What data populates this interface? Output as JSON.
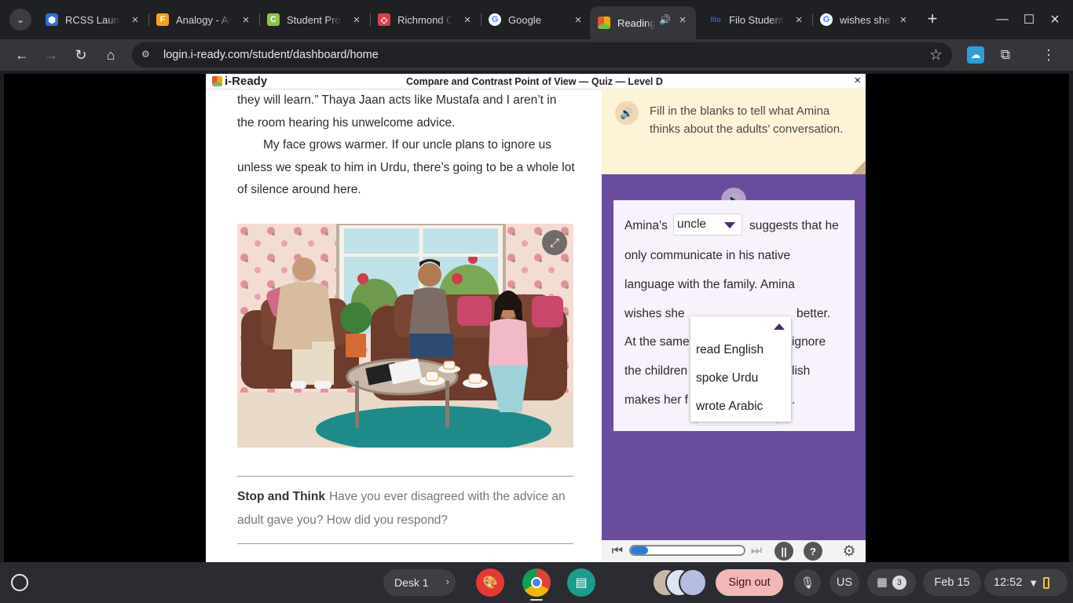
{
  "browser": {
    "tabs": [
      {
        "title": "RCSS Launchpad",
        "icon": "rcss-icon",
        "color": "#2f6fd6"
      },
      {
        "title": "Analogy - Ar",
        "icon": "analogy-icon",
        "color": "#f6a21b"
      },
      {
        "title": "Student Pro",
        "icon": "student-pro-icon",
        "color": "#8bc34a"
      },
      {
        "title": "Richmond C",
        "icon": "richmond-icon",
        "color": "#d9434a"
      },
      {
        "title": "Google",
        "icon": "google-icon",
        "color": "#4285f4"
      },
      {
        "title": "Reading",
        "icon": "iready-icon",
        "color": "#6cc04a",
        "active": true
      },
      {
        "title": "Filo Student",
        "icon": "filo-icon",
        "color": "#3b5bdb"
      },
      {
        "title": "wishes she",
        "icon": "google-icon",
        "color": "#4285f4"
      }
    ],
    "url": "login.i-ready.com/student/dashboard/home"
  },
  "app": {
    "logo": "i-Ready",
    "quiz_title": "Compare and Contrast Point of View — Quiz — Level D",
    "close": "×"
  },
  "passage": {
    "p1": "they will learn.” Thaya Jaan acts like Mustafa and I aren’t in the room hearing his unwelcome advice.",
    "p2": "My face grows warmer. If our uncle plans to ignore us unless we speak to him in Urdu, there’s going to be a whole lot of silence around here."
  },
  "stop_think": {
    "label": "Stop and Think",
    "text": "Have you ever disagreed with the advice an adult gave you? How did you respond?"
  },
  "question": {
    "instruction": "Fill in the blanks to tell what Amina thinks about the adults’ conversation.",
    "line1_a": "Amina’s",
    "dropdown1_value": "uncle",
    "line1_b": "suggests that he",
    "line2": "only communicate in his native",
    "line3": "language with the family. Amina",
    "line4_a": "wishes she",
    "line4_b": "better.",
    "line5_a": "At the same",
    "line5_b": "ignore",
    "line6_a": "the children",
    "line6_b": "lish",
    "line7_a": "makes her f",
    "line7_b": ".",
    "dropdown2_options": [
      "read English",
      "spoke Urdu",
      "wrote Arabic"
    ]
  },
  "player": {
    "progress": 0.15
  },
  "shelf": {
    "desk": "Desk 1",
    "signout": "Sign out",
    "lang": "US",
    "notifications": "3",
    "date": "Feb 15",
    "time": "12:52"
  }
}
